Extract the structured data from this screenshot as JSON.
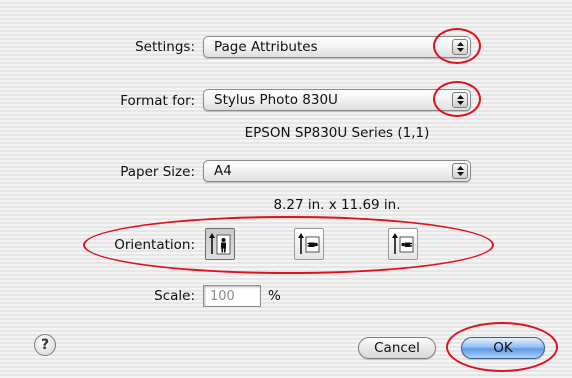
{
  "settings": {
    "label": "Settings:",
    "value": "Page Attributes"
  },
  "format_for": {
    "label": "Format for:",
    "value": "Stylus Photo 830U",
    "printer_description": "EPSON SP830U Series (1,1)"
  },
  "paper_size": {
    "label": "Paper Size:",
    "value": "A4",
    "dimensions": "8.27 in. x 11.69 in."
  },
  "orientation": {
    "label": "Orientation:",
    "options": [
      {
        "name": "portrait",
        "icon": "portrait-orientation-icon",
        "selected": true
      },
      {
        "name": "landscape",
        "icon": "landscape-orientation-icon",
        "selected": false
      },
      {
        "name": "reverse-landscape",
        "icon": "reverse-landscape-orientation-icon",
        "selected": false
      }
    ]
  },
  "scale": {
    "label": "Scale:",
    "value": "100",
    "unit": "%"
  },
  "buttons": {
    "help": "?",
    "cancel": "Cancel",
    "ok": "OK"
  },
  "annotation_color": "#e0101c"
}
